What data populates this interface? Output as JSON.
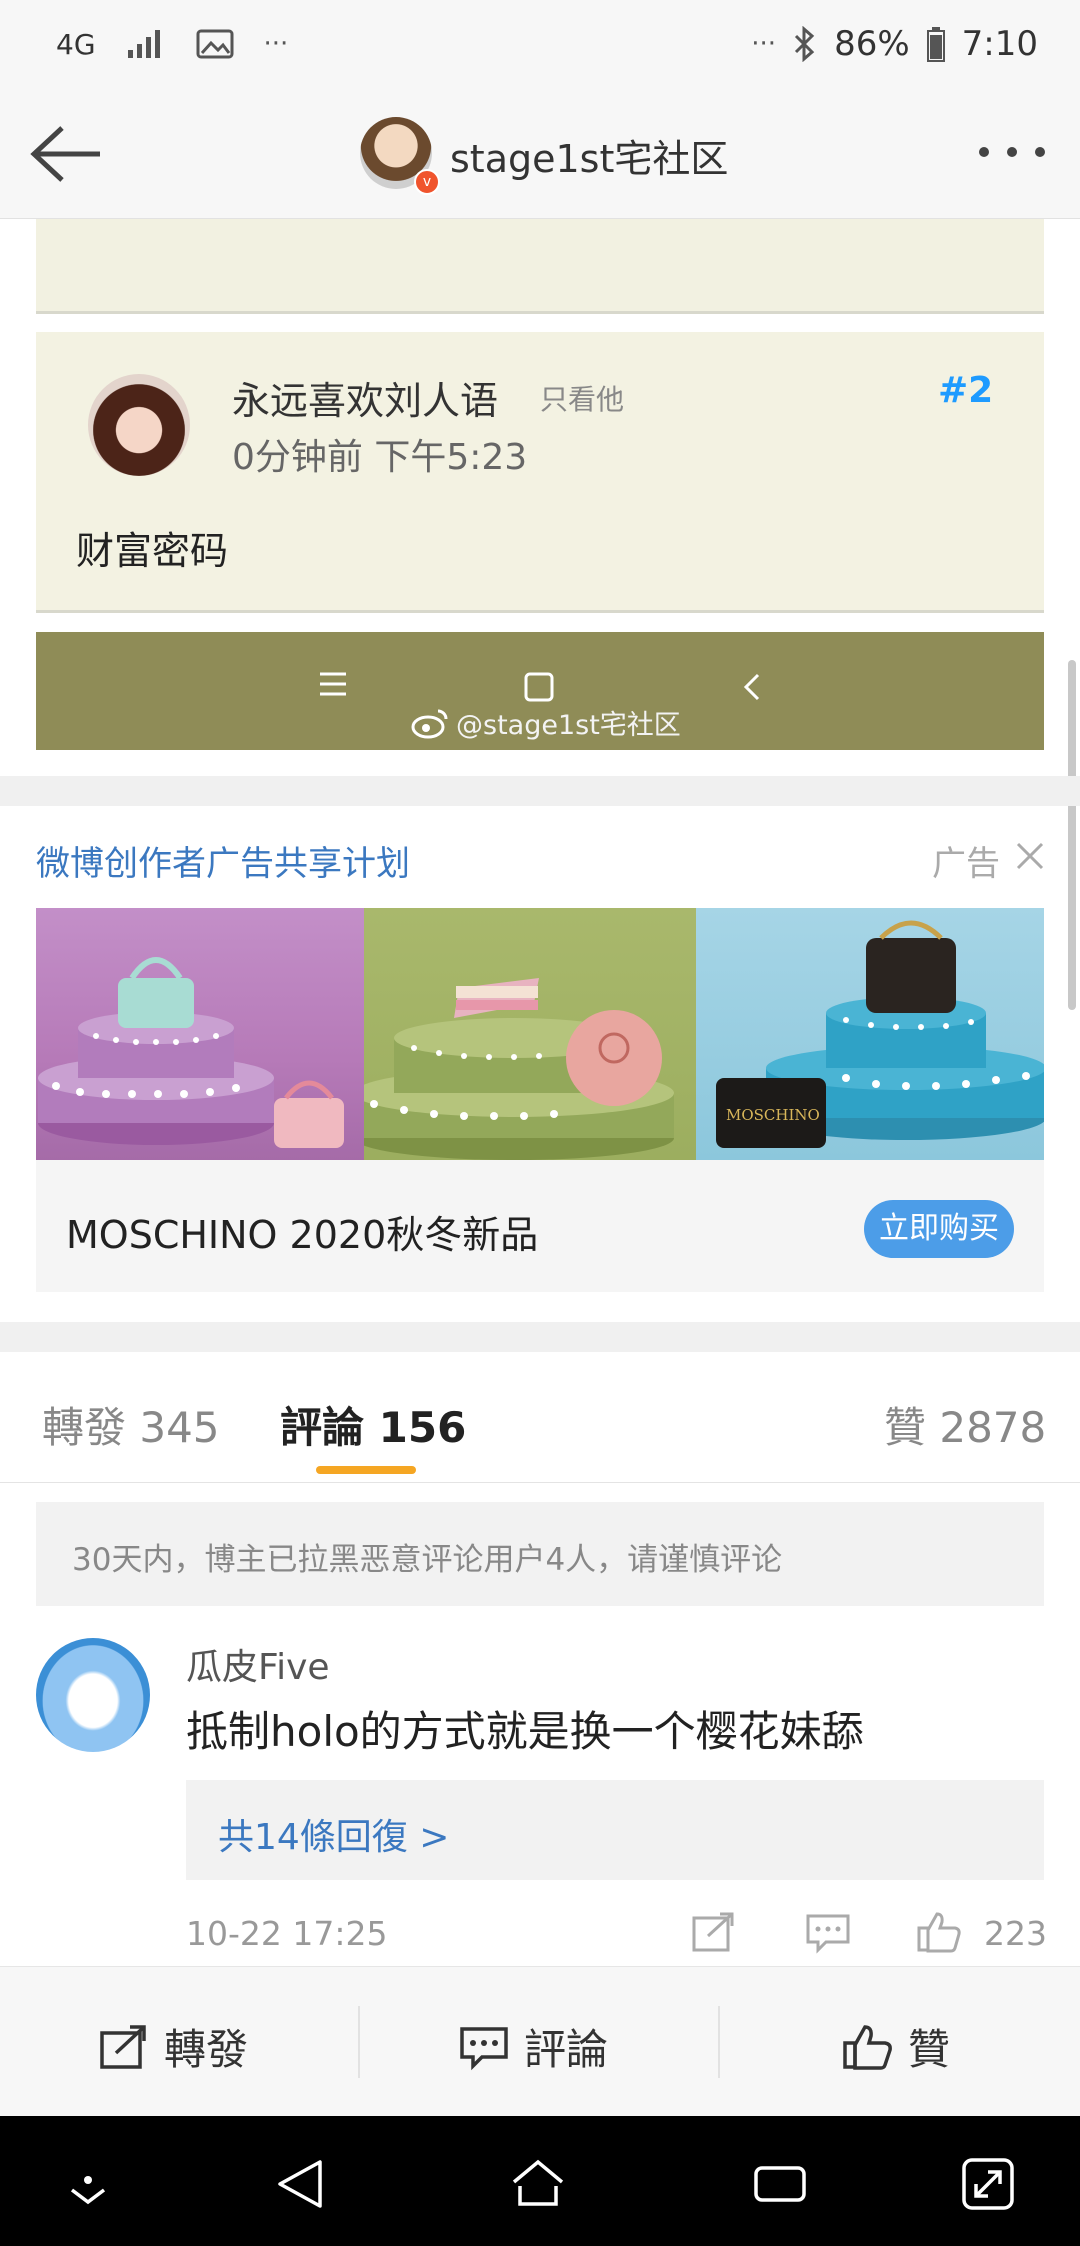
{
  "status_bar": {
    "network": "4G",
    "more_left": "···",
    "more_right": "···",
    "battery": "86%",
    "time": "7:10"
  },
  "nav": {
    "title": "stage1st宅社区"
  },
  "post": {
    "username": "永远喜欢刘人语",
    "only_him": "只看他",
    "floor": "#2",
    "time": "0分钟前 下午5:23",
    "text": "财富密码",
    "watermark": "@stage1st宅社区"
  },
  "ad": {
    "header": "微博创作者广告共享计划",
    "tag": "广告",
    "title": "MOSCHINO 2020秋冬新品",
    "buy_label": "立即购买",
    "bag_text": "MOSCHINO"
  },
  "tabs": {
    "repost": "轉發 345",
    "comments": "評論 156",
    "likes": "贊 2878"
  },
  "notice": "30天内，博主已拉黑恶意评论用户4人，请谨慎评论",
  "comment": {
    "name": "瓜皮Five",
    "text": "抵制holo的方式就是换一个樱花妹舔",
    "replies": "共14條回復 >",
    "date": "10-22 17:25",
    "like_count": "223"
  },
  "bottom_actions": {
    "repost": "轉發",
    "comment": "評論",
    "like": "贊"
  },
  "colors": {
    "accent_blue": "#3b78c0",
    "underline_orange": "#f5a623",
    "post_bg": "#f3f2e2",
    "phone_nav_olive": "#8f8c57",
    "buy_button": "#4c9de8",
    "floor_blue": "#1e9bff"
  }
}
